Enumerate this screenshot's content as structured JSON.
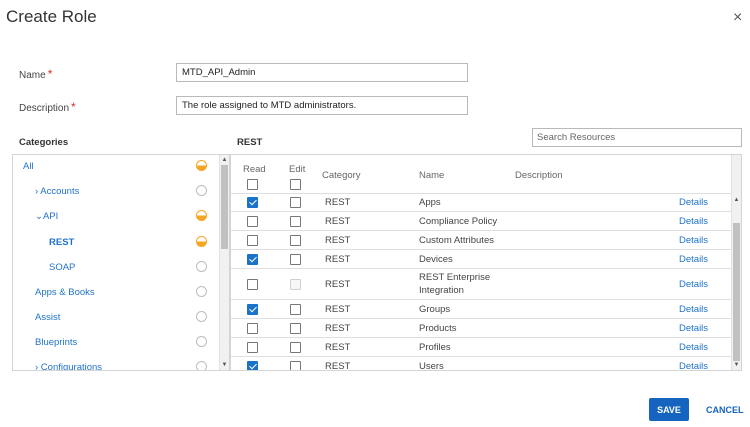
{
  "dialog": {
    "title": "Create Role",
    "close_icon": "×"
  },
  "form": {
    "name_label": "Name",
    "name_value": "MTD_API_Admin",
    "description_label": "Description",
    "description_value": "The role assigned to MTD administrators.",
    "required_mark": "*"
  },
  "categories": {
    "heading": "Categories",
    "items": [
      {
        "label": "All",
        "state": "partial"
      },
      {
        "label": "› Accounts",
        "state": "none"
      },
      {
        "label": "⌄API",
        "state": "partial"
      },
      {
        "label": "REST",
        "state": "partial"
      },
      {
        "label": "SOAP",
        "state": "none"
      },
      {
        "label": "Apps & Books",
        "state": "none"
      },
      {
        "label": "Assist",
        "state": "none"
      },
      {
        "label": "Blueprints",
        "state": "none"
      },
      {
        "label": "› Configurations",
        "state": "none"
      }
    ]
  },
  "resources": {
    "heading": "REST",
    "search_placeholder": "Search Resources",
    "columns": {
      "read": "Read",
      "edit": "Edit",
      "category": "Category",
      "name": "Name",
      "description": "Description"
    },
    "details_label": "Details",
    "rows": [
      {
        "category": "REST",
        "name": "Apps",
        "read": true,
        "edit": false,
        "edit_disabled": false
      },
      {
        "category": "REST",
        "name": "Compliance Policy",
        "read": false,
        "edit": false,
        "edit_disabled": false
      },
      {
        "category": "REST",
        "name": "Custom Attributes",
        "read": false,
        "edit": false,
        "edit_disabled": false
      },
      {
        "category": "REST",
        "name": "Devices",
        "read": true,
        "edit": false,
        "edit_disabled": false
      },
      {
        "category": "REST",
        "name": "REST Enterprise",
        "name2": "Integration",
        "read": false,
        "edit": false,
        "edit_disabled": true
      },
      {
        "category": "REST",
        "name": "Groups",
        "read": true,
        "edit": false,
        "edit_disabled": false
      },
      {
        "category": "REST",
        "name": "Products",
        "read": false,
        "edit": false,
        "edit_disabled": false
      },
      {
        "category": "REST",
        "name": "Profiles",
        "read": false,
        "edit": false,
        "edit_disabled": false
      },
      {
        "category": "REST",
        "name": "Users",
        "read": true,
        "edit": false,
        "edit_disabled": false
      }
    ]
  },
  "footer": {
    "save_label": "SAVE",
    "cancel_label": "CANCEL"
  },
  "colors": {
    "accent": "#1565c0",
    "link": "#1f73c9",
    "partial": "#f5a623",
    "required": "#d0312d"
  }
}
